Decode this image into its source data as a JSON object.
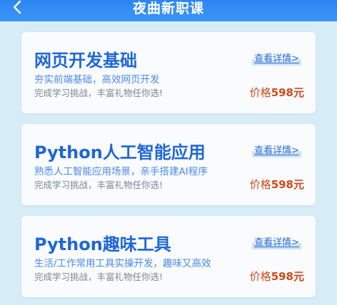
{
  "header": {
    "title": "夜曲新职课",
    "back_icon": "chevron-left-icon"
  },
  "courses": [
    {
      "title": "网页开发基础",
      "details_label": "查看详情>",
      "description": "夯实前端基础，高效网页开发",
      "subtitle": "完成学习挑战，丰富礼物任你选!",
      "price_label": "价格",
      "price_value": "598元"
    },
    {
      "title": "Python人工智能应用",
      "details_label": "查看详情>",
      "description": "熟悉人工智能应用场景，亲手搭建AI程序",
      "subtitle": "完成学习挑战，丰富礼物任你选!",
      "price_label": "价格",
      "price_value": "598元"
    },
    {
      "title": "Python趣味工具",
      "details_label": "查看详情>",
      "description": "生活/工作常用工具实操开发，趣味又高效",
      "subtitle": "完成学习挑战，丰富礼物任你选!",
      "price_label": "价格",
      "price_value": "598元"
    }
  ],
  "colors": {
    "header_blue": "#2c86f2",
    "title_blue": "#1f67d6",
    "desc_blue": "#4d8ae8",
    "price_orange": "#cf4a1b",
    "background": "#d6ecf6"
  }
}
